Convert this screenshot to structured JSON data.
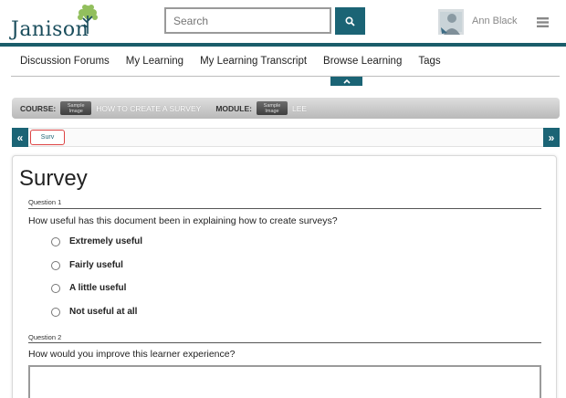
{
  "header": {
    "logo_text": "Janison",
    "search_placeholder": "Search",
    "user_name": "Ann Black",
    "colors": {
      "accent": "#1b6475",
      "bar": "#1a5d6a"
    }
  },
  "nav": {
    "items": [
      {
        "label": "Discussion Forums"
      },
      {
        "label": "My Learning"
      },
      {
        "label": "My Learning Transcript"
      },
      {
        "label": "Browse Learning"
      },
      {
        "label": "Tags"
      }
    ]
  },
  "course_bar": {
    "course_label": "COURSE:",
    "course_thumb_text": [
      "Sample",
      "Image"
    ],
    "course_value": "HOW TO CREATE A SURVEY",
    "module_label": "MODULE:",
    "module_thumb_text": [
      "Sample",
      "Image"
    ],
    "module_value": "LEE"
  },
  "breadcrumb": {
    "prev": "«",
    "next": "»",
    "current_item": "Surv"
  },
  "content": {
    "title": "Survey",
    "questions": [
      {
        "label": "Question 1",
        "text": "How useful has this document been in explaining how to create surveys?",
        "options": [
          "Extremely useful",
          "Fairly useful",
          "A little useful",
          "Not useful at all"
        ]
      },
      {
        "label": "Question 2",
        "text": "How would you improve this learner experience?"
      }
    ]
  }
}
